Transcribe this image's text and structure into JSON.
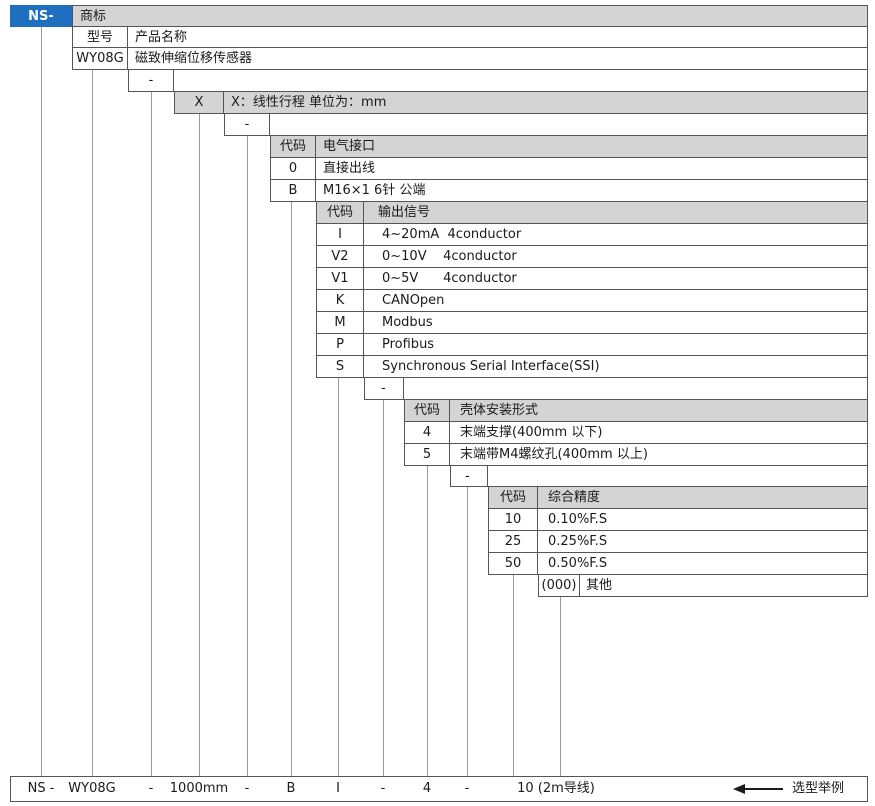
{
  "brand": {
    "prefix": "NS-",
    "brand_label": "商标",
    "model_label": "型号",
    "product_name_label": "产品名称",
    "model_code": "WY08G",
    "product_name": "磁致伸缩位移传感器"
  },
  "separators": {
    "dash": "-"
  },
  "stroke": {
    "code": "X",
    "description": "X：线性行程 单位为：mm"
  },
  "electrical": {
    "header_code": "代码",
    "header_label": "电气接口",
    "rows": [
      {
        "code": "0",
        "label": "直接出线"
      },
      {
        "code": "B",
        "label": "M16×1 6针 公端"
      }
    ]
  },
  "output": {
    "header_code": "代码",
    "header_label": "输出信号",
    "rows": [
      {
        "code": "I",
        "label": "4~20mA  4conductor"
      },
      {
        "code": "V2",
        "label": "0~10V    4conductor"
      },
      {
        "code": "V1",
        "label": "0~5V      4conductor"
      },
      {
        "code": "K",
        "label": "CANOpen"
      },
      {
        "code": "M",
        "label": "Modbus"
      },
      {
        "code": "P",
        "label": "Profibus"
      },
      {
        "code": "S",
        "label": "Synchronous Serial Interface(SSI)"
      }
    ]
  },
  "mounting": {
    "header_code": "代码",
    "header_label": "壳体安装形式",
    "rows": [
      {
        "code": "4",
        "label": "末端支撑(400mm 以下)"
      },
      {
        "code": "5",
        "label": "末端带M4螺纹孔(400mm 以上)"
      }
    ]
  },
  "accuracy": {
    "header_code": "代码",
    "header_label": "综合精度",
    "rows": [
      {
        "code": "10",
        "label": "0.10%F.S"
      },
      {
        "code": "25",
        "label": "0.25%F.S"
      },
      {
        "code": "50",
        "label": "0.50%F.S"
      },
      {
        "code": "(000)",
        "label": "其他"
      }
    ]
  },
  "example": {
    "items": [
      "NS -",
      "WY08G",
      "-",
      "1000mm",
      "-",
      "B",
      "I",
      "-",
      "4",
      "-",
      "10 (2m导线)"
    ],
    "label": "选型举例"
  },
  "colors": {
    "logo_bg": "#1f6fbf",
    "header_bg": "#d4d4d4",
    "line": "#555555"
  }
}
